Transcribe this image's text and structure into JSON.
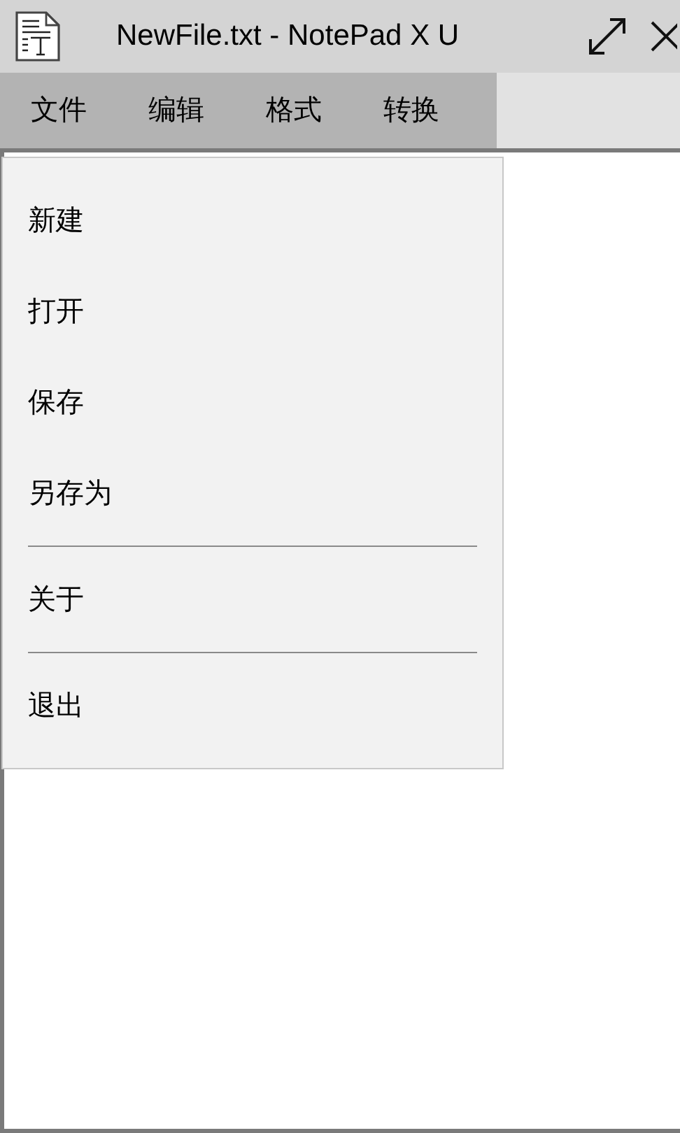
{
  "window": {
    "title": "NewFile.txt - NotePad X U"
  },
  "menu_bar": [
    {
      "label": "文件"
    },
    {
      "label": "编辑"
    },
    {
      "label": "格式"
    },
    {
      "label": "转换"
    }
  ],
  "dropdown": {
    "items": [
      {
        "kind": "command",
        "label": "新建"
      },
      {
        "kind": "command",
        "label": "打开"
      },
      {
        "kind": "command",
        "label": "保存"
      },
      {
        "kind": "command",
        "label": "另存为"
      },
      {
        "kind": "separator"
      },
      {
        "kind": "command",
        "label": "关于"
      },
      {
        "kind": "separator"
      },
      {
        "kind": "command",
        "label": "退出"
      }
    ]
  }
}
